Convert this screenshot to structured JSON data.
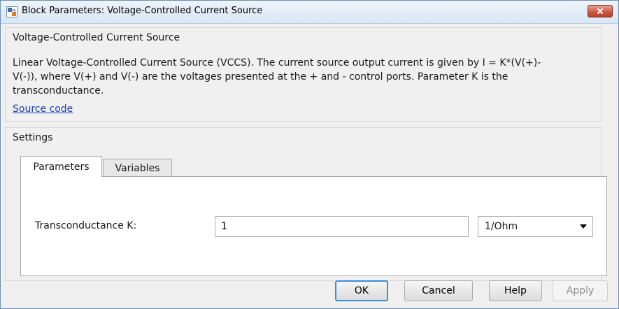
{
  "window": {
    "title": "Block Parameters: Voltage-Controlled Current Source"
  },
  "description_panel": {
    "title": "Voltage-Controlled Current Source",
    "line1": "Linear Voltage-Controlled Current Source (VCCS). The current source output current is given by I = K*(V(+)-",
    "line2": "V(-)), where V(+) and V(-) are the voltages presented at the + and - control ports. Parameter K is the",
    "line3": "transconductance.",
    "link_label": "Source code"
  },
  "settings": {
    "title": "Settings",
    "tabs": [
      {
        "label": "Parameters",
        "active": true
      },
      {
        "label": "Variables",
        "active": false
      }
    ],
    "parameter": {
      "label": "Transconductance K:",
      "value": "1",
      "unit": "1/Ohm"
    }
  },
  "buttons": {
    "ok": "OK",
    "cancel": "Cancel",
    "help": "Help",
    "apply": "Apply"
  },
  "colors": {
    "titlebar": "#d9e6f5",
    "close_button": "#c95a45",
    "link": "#1a3fb3",
    "default_button_border": "#3c8ed8"
  },
  "icons": {
    "app": "simulink-block-icon",
    "close": "close-icon",
    "dropdown": "chevron-down-icon"
  }
}
